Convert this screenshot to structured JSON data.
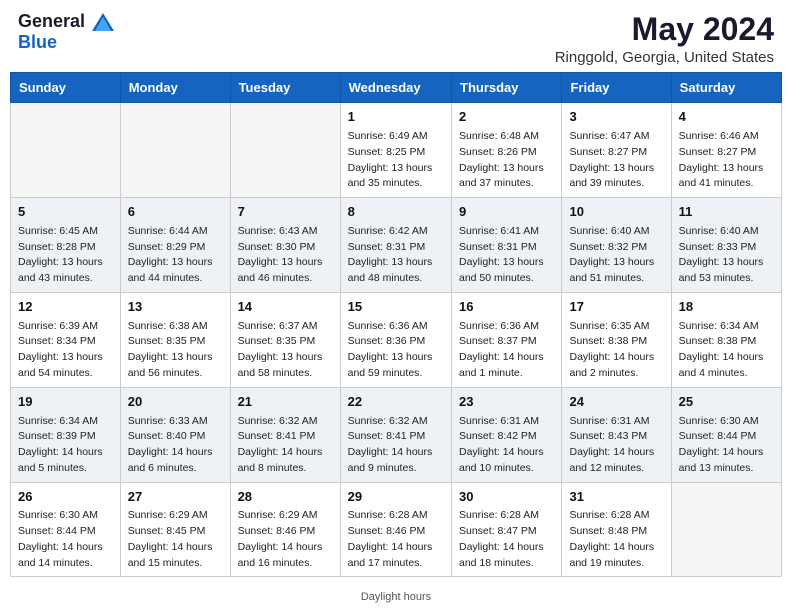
{
  "header": {
    "logo_general": "General",
    "logo_blue": "Blue",
    "month_title": "May 2024",
    "location": "Ringgold, Georgia, United States"
  },
  "days_of_week": [
    "Sunday",
    "Monday",
    "Tuesday",
    "Wednesday",
    "Thursday",
    "Friday",
    "Saturday"
  ],
  "weeks": [
    [
      {
        "num": "",
        "info": ""
      },
      {
        "num": "",
        "info": ""
      },
      {
        "num": "",
        "info": ""
      },
      {
        "num": "1",
        "info": "Sunrise: 6:49 AM\nSunset: 8:25 PM\nDaylight: 13 hours\nand 35 minutes."
      },
      {
        "num": "2",
        "info": "Sunrise: 6:48 AM\nSunset: 8:26 PM\nDaylight: 13 hours\nand 37 minutes."
      },
      {
        "num": "3",
        "info": "Sunrise: 6:47 AM\nSunset: 8:27 PM\nDaylight: 13 hours\nand 39 minutes."
      },
      {
        "num": "4",
        "info": "Sunrise: 6:46 AM\nSunset: 8:27 PM\nDaylight: 13 hours\nand 41 minutes."
      }
    ],
    [
      {
        "num": "5",
        "info": "Sunrise: 6:45 AM\nSunset: 8:28 PM\nDaylight: 13 hours\nand 43 minutes."
      },
      {
        "num": "6",
        "info": "Sunrise: 6:44 AM\nSunset: 8:29 PM\nDaylight: 13 hours\nand 44 minutes."
      },
      {
        "num": "7",
        "info": "Sunrise: 6:43 AM\nSunset: 8:30 PM\nDaylight: 13 hours\nand 46 minutes."
      },
      {
        "num": "8",
        "info": "Sunrise: 6:42 AM\nSunset: 8:31 PM\nDaylight: 13 hours\nand 48 minutes."
      },
      {
        "num": "9",
        "info": "Sunrise: 6:41 AM\nSunset: 8:31 PM\nDaylight: 13 hours\nand 50 minutes."
      },
      {
        "num": "10",
        "info": "Sunrise: 6:40 AM\nSunset: 8:32 PM\nDaylight: 13 hours\nand 51 minutes."
      },
      {
        "num": "11",
        "info": "Sunrise: 6:40 AM\nSunset: 8:33 PM\nDaylight: 13 hours\nand 53 minutes."
      }
    ],
    [
      {
        "num": "12",
        "info": "Sunrise: 6:39 AM\nSunset: 8:34 PM\nDaylight: 13 hours\nand 54 minutes."
      },
      {
        "num": "13",
        "info": "Sunrise: 6:38 AM\nSunset: 8:35 PM\nDaylight: 13 hours\nand 56 minutes."
      },
      {
        "num": "14",
        "info": "Sunrise: 6:37 AM\nSunset: 8:35 PM\nDaylight: 13 hours\nand 58 minutes."
      },
      {
        "num": "15",
        "info": "Sunrise: 6:36 AM\nSunset: 8:36 PM\nDaylight: 13 hours\nand 59 minutes."
      },
      {
        "num": "16",
        "info": "Sunrise: 6:36 AM\nSunset: 8:37 PM\nDaylight: 14 hours\nand 1 minute."
      },
      {
        "num": "17",
        "info": "Sunrise: 6:35 AM\nSunset: 8:38 PM\nDaylight: 14 hours\nand 2 minutes."
      },
      {
        "num": "18",
        "info": "Sunrise: 6:34 AM\nSunset: 8:38 PM\nDaylight: 14 hours\nand 4 minutes."
      }
    ],
    [
      {
        "num": "19",
        "info": "Sunrise: 6:34 AM\nSunset: 8:39 PM\nDaylight: 14 hours\nand 5 minutes."
      },
      {
        "num": "20",
        "info": "Sunrise: 6:33 AM\nSunset: 8:40 PM\nDaylight: 14 hours\nand 6 minutes."
      },
      {
        "num": "21",
        "info": "Sunrise: 6:32 AM\nSunset: 8:41 PM\nDaylight: 14 hours\nand 8 minutes."
      },
      {
        "num": "22",
        "info": "Sunrise: 6:32 AM\nSunset: 8:41 PM\nDaylight: 14 hours\nand 9 minutes."
      },
      {
        "num": "23",
        "info": "Sunrise: 6:31 AM\nSunset: 8:42 PM\nDaylight: 14 hours\nand 10 minutes."
      },
      {
        "num": "24",
        "info": "Sunrise: 6:31 AM\nSunset: 8:43 PM\nDaylight: 14 hours\nand 12 minutes."
      },
      {
        "num": "25",
        "info": "Sunrise: 6:30 AM\nSunset: 8:44 PM\nDaylight: 14 hours\nand 13 minutes."
      }
    ],
    [
      {
        "num": "26",
        "info": "Sunrise: 6:30 AM\nSunset: 8:44 PM\nDaylight: 14 hours\nand 14 minutes."
      },
      {
        "num": "27",
        "info": "Sunrise: 6:29 AM\nSunset: 8:45 PM\nDaylight: 14 hours\nand 15 minutes."
      },
      {
        "num": "28",
        "info": "Sunrise: 6:29 AM\nSunset: 8:46 PM\nDaylight: 14 hours\nand 16 minutes."
      },
      {
        "num": "29",
        "info": "Sunrise: 6:28 AM\nSunset: 8:46 PM\nDaylight: 14 hours\nand 17 minutes."
      },
      {
        "num": "30",
        "info": "Sunrise: 6:28 AM\nSunset: 8:47 PM\nDaylight: 14 hours\nand 18 minutes."
      },
      {
        "num": "31",
        "info": "Sunrise: 6:28 AM\nSunset: 8:48 PM\nDaylight: 14 hours\nand 19 minutes."
      },
      {
        "num": "",
        "info": ""
      }
    ]
  ],
  "footer": {
    "daylight_label": "Daylight hours"
  }
}
